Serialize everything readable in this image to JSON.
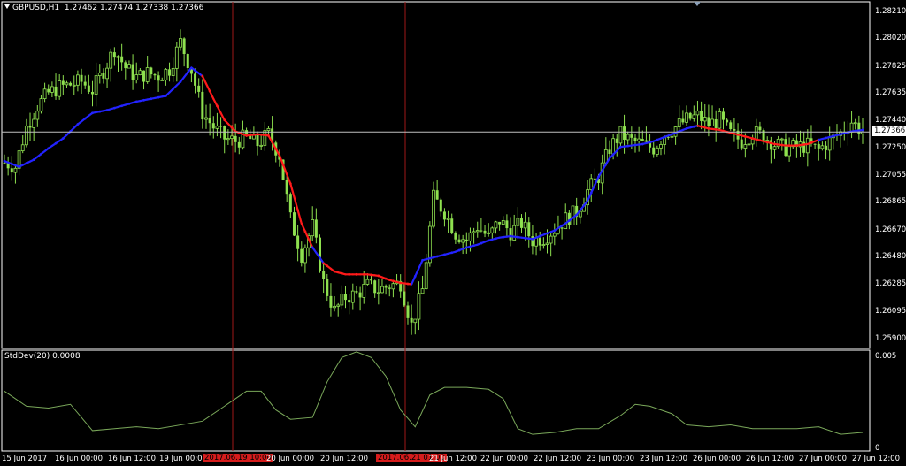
{
  "header": {
    "symbol": "GBPUSD,H1",
    "ohlc": "1.27462 1.27474 1.27338 1.27366"
  },
  "indicator": {
    "label": "StdDev(20) 0.0008",
    "scale_max": "0.005",
    "scale_min": "0"
  },
  "current_price": "1.27366",
  "colors": {
    "background": "#000000",
    "candle": "#8ee04f",
    "ma_up": "#2323ff",
    "ma_down": "#ff1a1a",
    "stddev": "#7aa85a",
    "vline": "#a01818",
    "highlight": "#d61c1c"
  },
  "chart_data": {
    "type": "candlestick",
    "price_axis_ticks": [
      "1.28210",
      "1.28020",
      "1.27825",
      "1.27635",
      "1.27440",
      "1.27250",
      "1.27055",
      "1.26865",
      "1.26670",
      "1.26480",
      "1.26285",
      "1.26095",
      "1.25900"
    ],
    "ylim": [
      1.2585,
      1.2826
    ],
    "time_axis_labels": [
      {
        "text": "15 Jun 2017",
        "highlight": false
      },
      {
        "text": "16 Jun 00:00",
        "highlight": false
      },
      {
        "text": "16 Jun 12:00",
        "highlight": false
      },
      {
        "text": "19 Jun 00:00",
        "highlight": false
      },
      {
        "text": "2017.06.19 10:00",
        "highlight": true
      },
      {
        "text": "20 Jun 00:00",
        "highlight": false
      },
      {
        "text": "20 Jun 12:00",
        "highlight": false
      },
      {
        "text": "2017.06.21 01:00",
        "highlight": true
      },
      {
        "text": "21 Jun 12:00",
        "highlight": false
      },
      {
        "text": "22 Jun 00:00",
        "highlight": false
      },
      {
        "text": "22 Jun 12:00",
        "highlight": false
      },
      {
        "text": "23 Jun 00:00",
        "highlight": false
      },
      {
        "text": "23 Jun 12:00",
        "highlight": false
      },
      {
        "text": "26 Jun 00:00",
        "highlight": false
      },
      {
        "text": "26 Jun 12:00",
        "highlight": false
      },
      {
        "text": "27 Jun 00:00",
        "highlight": false
      },
      {
        "text": "27 Jun 12:00",
        "highlight": false
      }
    ],
    "close_path": [
      [
        0,
        1.2715
      ],
      [
        3,
        1.2712
      ],
      [
        6,
        1.274
      ],
      [
        9,
        1.2755
      ],
      [
        12,
        1.2764
      ],
      [
        15,
        1.2768
      ],
      [
        18,
        1.277
      ],
      [
        21,
        1.2772
      ],
      [
        24,
        1.2766
      ],
      [
        27,
        1.278
      ],
      [
        30,
        1.2795
      ],
      [
        33,
        1.2782
      ],
      [
        36,
        1.2775
      ],
      [
        39,
        1.2778
      ],
      [
        42,
        1.2776
      ],
      [
        45,
        1.2781
      ],
      [
        48,
        1.28
      ],
      [
        51,
        1.278
      ],
      [
        54,
        1.275
      ],
      [
        57,
        1.274
      ],
      [
        60,
        1.2732
      ],
      [
        63,
        1.273
      ],
      [
        66,
        1.2733
      ],
      [
        69,
        1.2728
      ],
      [
        72,
        1.2735
      ],
      [
        75,
        1.272
      ],
      [
        78,
        1.2675
      ],
      [
        81,
        1.265
      ],
      [
        84,
        1.267
      ],
      [
        87,
        1.263
      ],
      [
        90,
        1.261
      ],
      [
        93,
        1.262
      ],
      [
        96,
        1.2622
      ],
      [
        99,
        1.2628
      ],
      [
        102,
        1.2625
      ],
      [
        105,
        1.2628
      ],
      [
        108,
        1.263
      ],
      [
        111,
        1.26
      ],
      [
        114,
        1.2625
      ],
      [
        117,
        1.269
      ],
      [
        120,
        1.268
      ],
      [
        123,
        1.2665
      ],
      [
        126,
        1.266
      ],
      [
        129,
        1.267
      ],
      [
        132,
        1.2662
      ],
      [
        135,
        1.2674
      ],
      [
        138,
        1.2666
      ],
      [
        141,
        1.2672
      ],
      [
        144,
        1.266
      ],
      [
        147,
        1.2662
      ],
      [
        150,
        1.2668
      ],
      [
        153,
        1.2675
      ],
      [
        156,
        1.268
      ],
      [
        159,
        1.2695
      ],
      [
        162,
        1.2705
      ],
      [
        165,
        1.2725
      ],
      [
        168,
        1.2735
      ],
      [
        171,
        1.273
      ],
      [
        174,
        1.2728
      ],
      [
        177,
        1.2725
      ],
      [
        180,
        1.2735
      ],
      [
        183,
        1.274
      ],
      [
        186,
        1.2745
      ],
      [
        189,
        1.2748
      ],
      [
        192,
        1.2742
      ],
      [
        195,
        1.2745
      ],
      [
        198,
        1.2735
      ],
      [
        201,
        1.273
      ],
      [
        204,
        1.2736
      ],
      [
        207,
        1.2734
      ],
      [
        210,
        1.2728
      ],
      [
        213,
        1.2725
      ],
      [
        216,
        1.2726
      ],
      [
        219,
        1.2727
      ],
      [
        222,
        1.2724
      ],
      [
        225,
        1.273
      ],
      [
        228,
        1.2736
      ],
      [
        231,
        1.2744
      ],
      [
        234,
        1.2737
      ]
    ],
    "ma_path": [
      [
        0,
        1.2716
      ],
      [
        4,
        1.2712
      ],
      [
        8,
        1.2717
      ],
      [
        12,
        1.2725
      ],
      [
        16,
        1.2732
      ],
      [
        20,
        1.2742
      ],
      [
        24,
        1.275
      ],
      [
        28,
        1.2752
      ],
      [
        32,
        1.2755
      ],
      [
        36,
        1.2758
      ],
      [
        40,
        1.276
      ],
      [
        44,
        1.2762
      ],
      [
        48,
        1.2772
      ],
      [
        51,
        1.2782
      ],
      [
        54,
        1.2776
      ],
      [
        57,
        1.276
      ],
      [
        60,
        1.2745
      ],
      [
        63,
        1.2737
      ],
      [
        66,
        1.2734
      ],
      [
        69,
        1.2735
      ],
      [
        72,
        1.2734
      ],
      [
        75,
        1.272
      ],
      [
        78,
        1.27
      ],
      [
        81,
        1.2672
      ],
      [
        84,
        1.2655
      ],
      [
        87,
        1.2644
      ],
      [
        90,
        1.2638
      ],
      [
        93,
        1.2636
      ],
      [
        96,
        1.2636
      ],
      [
        99,
        1.2636
      ],
      [
        102,
        1.2635
      ],
      [
        105,
        1.2632
      ],
      [
        108,
        1.263
      ],
      [
        111,
        1.2629
      ],
      [
        114,
        1.2646
      ],
      [
        117,
        1.2648
      ],
      [
        120,
        1.265
      ],
      [
        123,
        1.2652
      ],
      [
        126,
        1.2655
      ],
      [
        129,
        1.2657
      ],
      [
        132,
        1.266
      ],
      [
        135,
        1.2662
      ],
      [
        138,
        1.2663
      ],
      [
        141,
        1.2662
      ],
      [
        144,
        1.2661
      ],
      [
        147,
        1.2664
      ],
      [
        150,
        1.2667
      ],
      [
        153,
        1.2672
      ],
      [
        156,
        1.2678
      ],
      [
        159,
        1.2688
      ],
      [
        162,
        1.2705
      ],
      [
        165,
        1.2718
      ],
      [
        168,
        1.2726
      ],
      [
        171,
        1.2727
      ],
      [
        174,
        1.2728
      ],
      [
        177,
        1.273
      ],
      [
        180,
        1.2733
      ],
      [
        183,
        1.2736
      ],
      [
        186,
        1.2739
      ],
      [
        189,
        1.2741
      ],
      [
        192,
        1.2739
      ],
      [
        195,
        1.2738
      ],
      [
        198,
        1.2736
      ],
      [
        201,
        1.2734
      ],
      [
        204,
        1.2732
      ],
      [
        207,
        1.273
      ],
      [
        210,
        1.2728
      ],
      [
        213,
        1.2727
      ],
      [
        216,
        1.2727
      ],
      [
        219,
        1.2728
      ],
      [
        222,
        1.2731
      ],
      [
        225,
        1.2733
      ],
      [
        228,
        1.2735
      ],
      [
        231,
        1.2737
      ],
      [
        234,
        1.2738
      ]
    ],
    "ma_down_segments": [
      [
        54,
        84
      ],
      [
        87,
        111
      ],
      [
        189,
        222
      ]
    ],
    "stddev": {
      "ylim": [
        0,
        0.005
      ],
      "values": [
        [
          0,
          0.003
        ],
        [
          6,
          0.0022
        ],
        [
          12,
          0.0021
        ],
        [
          18,
          0.0023
        ],
        [
          24,
          0.0009
        ],
        [
          30,
          0.001
        ],
        [
          36,
          0.0011
        ],
        [
          42,
          0.001
        ],
        [
          48,
          0.0012
        ],
        [
          54,
          0.0014
        ],
        [
          60,
          0.0022
        ],
        [
          66,
          0.003
        ],
        [
          70,
          0.003
        ],
        [
          74,
          0.002
        ],
        [
          78,
          0.0015
        ],
        [
          84,
          0.0016
        ],
        [
          88,
          0.0035
        ],
        [
          92,
          0.0048
        ],
        [
          96,
          0.0051
        ],
        [
          100,
          0.0048
        ],
        [
          104,
          0.0038
        ],
        [
          108,
          0.002
        ],
        [
          112,
          0.0011
        ],
        [
          116,
          0.0028
        ],
        [
          120,
          0.0032
        ],
        [
          126,
          0.0032
        ],
        [
          132,
          0.0031
        ],
        [
          136,
          0.0026
        ],
        [
          140,
          0.001
        ],
        [
          144,
          0.0007
        ],
        [
          150,
          0.0008
        ],
        [
          156,
          0.001
        ],
        [
          162,
          0.001
        ],
        [
          168,
          0.0017
        ],
        [
          172,
          0.0023
        ],
        [
          176,
          0.0022
        ],
        [
          182,
          0.0018
        ],
        [
          186,
          0.0012
        ],
        [
          192,
          0.0011
        ],
        [
          198,
          0.0012
        ],
        [
          204,
          0.001
        ],
        [
          210,
          0.001
        ],
        [
          216,
          0.001
        ],
        [
          222,
          0.0011
        ],
        [
          228,
          0.0007
        ],
        [
          234,
          0.0008
        ]
      ]
    }
  }
}
